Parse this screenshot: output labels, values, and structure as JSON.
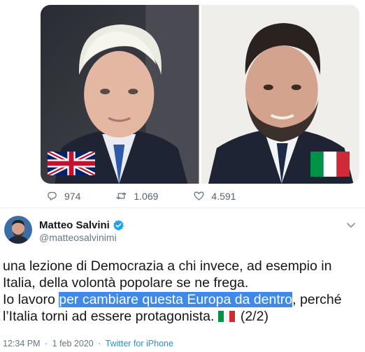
{
  "previous_tweet": {
    "media": [
      {
        "icon": "uk-flag-icon"
      },
      {
        "icon": "italy-flag-icon"
      }
    ],
    "actions": {
      "reply_count": "974",
      "retweet_count": "1.069",
      "like_count": "4.591"
    }
  },
  "tweet": {
    "author": {
      "name": "Matteo Salvini",
      "handle": "@matteosalvinimi",
      "verified": true
    },
    "text_lines": {
      "line1": "una lezione di Democrazia a chi invece, ad esempio in",
      "line2": "Italia, della volontà popolare se ne frega.",
      "line3_pre": "Io lavoro ",
      "line3_highlight": "per cambiare questa Europa da dentro",
      "line3_post": ", perché",
      "line4_pre": "l’Italia torni ad essere protagonista.",
      "line4_post": "(2/2)"
    },
    "meta": {
      "time": "12:34 PM",
      "separator": "·",
      "date": "1 feb 2020",
      "source": "Twitter for iPhone"
    }
  },
  "colors": {
    "accent": "#1da1f2",
    "highlight": "#3f8ae8",
    "secondary_text": "#657786"
  }
}
